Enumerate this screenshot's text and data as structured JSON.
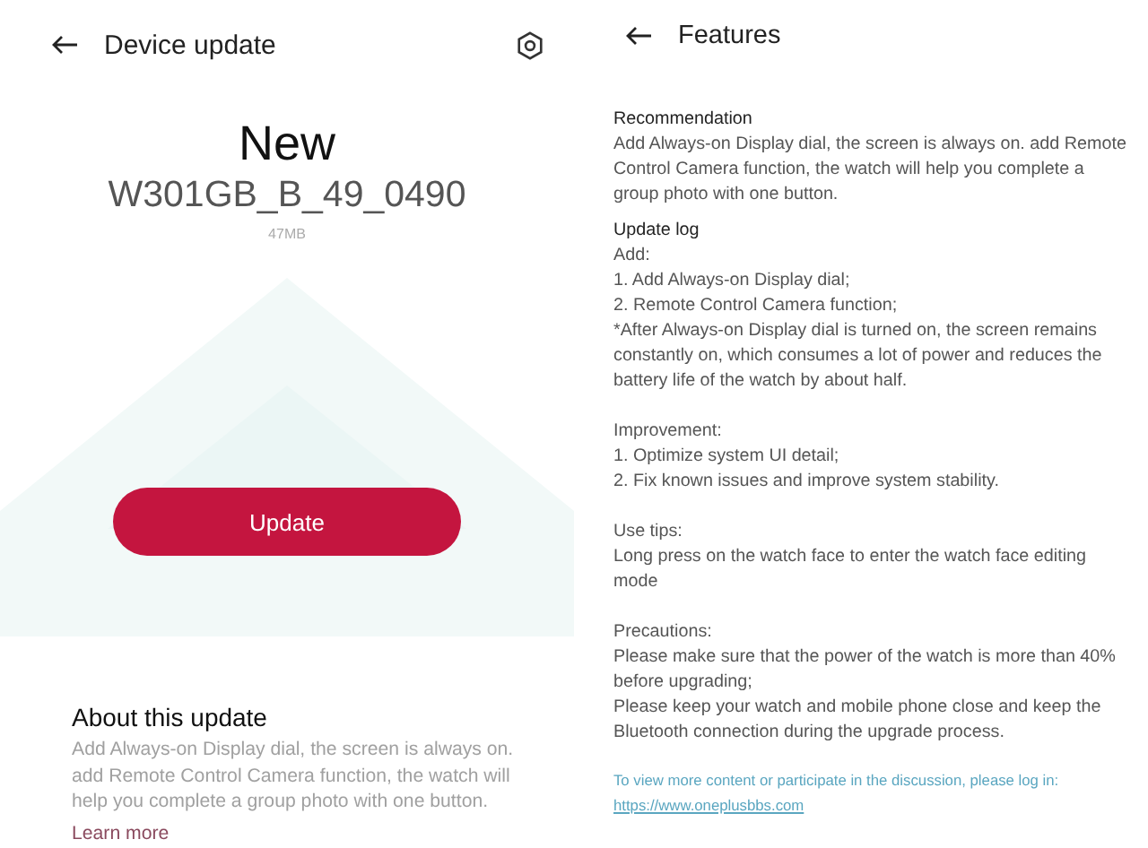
{
  "device_update": {
    "title": "Device update",
    "status": "New",
    "version": "W301GB_B_49_0490",
    "size": "47MB",
    "button": "Update",
    "about": {
      "title": "About this update",
      "text": "Add Always-on Display dial, the screen is always on. add Remote Control Camera function, the watch will help you complete a group photo with one button.",
      "link": "Learn more"
    }
  },
  "features": {
    "title": "Features",
    "sections": [
      {
        "heading": "Recommendation",
        "paragraphs": [
          [
            "Add Always-on Display dial, the screen is always on. add Remote Control Camera function, the watch will help you complete a group photo with one button."
          ]
        ]
      },
      {
        "heading": "Update log",
        "paragraphs": [
          [
            "Add:",
            "1. Add Always-on Display dial;",
            "2. Remote Control Camera function;",
            "*After Always-on Display dial is turned on, the screen remains constantly on, which consumes a lot of power and reduces the battery life of the watch by about half."
          ],
          [
            "Improvement:",
            "1. Optimize system UI detail;",
            "2. Fix known issues and improve system stability."
          ],
          [
            "Use tips:",
            "Long press on the watch face to enter the watch face editing mode"
          ],
          [
            "Precautions:",
            "Please make sure that the power of the watch is more than 40% before upgrading;",
            "Please keep your watch and mobile phone close and keep the Bluetooth connection during the upgrade process."
          ]
        ]
      }
    ],
    "footer": {
      "text": "To view more content or participate in the discussion, please log in:",
      "link": "https://www.oneplusbbs.com"
    }
  }
}
